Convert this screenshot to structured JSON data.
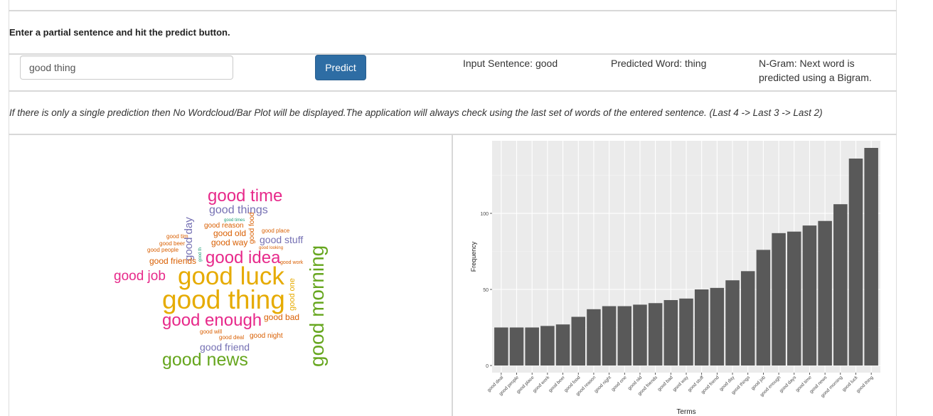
{
  "instructions": "Enter a partial sentence and hit the predict button.",
  "input": {
    "value": "good thing"
  },
  "predict_button_label": "Predict",
  "results": {
    "input_sentence": "Input Sentence: good",
    "predicted_word": "Predicted Word: thing",
    "ngram_line1": "N-Gram: Next word is",
    "ngram_line2": "predicted using a Bigram."
  },
  "note": "If there is only a single prediction then No Wordcloud/Bar Plot will be displayed.The application will always check using the last set of words of the entered sentence. (Last 4 -> Last 3 -> Last 2)",
  "wordcloud": {
    "words": [
      {
        "text": "good time",
        "color": "#e7298a"
      },
      {
        "text": "good things",
        "color": "#7570b3"
      },
      {
        "text": "good times",
        "color": "#1b9e77"
      },
      {
        "text": "good reason",
        "color": "#d95f02"
      },
      {
        "text": "good old",
        "color": "#d95f02"
      },
      {
        "text": "good place",
        "color": "#d95f02"
      },
      {
        "text": "good tim",
        "color": "#d95f02"
      },
      {
        "text": "good beer",
        "color": "#d95f02"
      },
      {
        "text": "good people",
        "color": "#d95f02"
      },
      {
        "text": "good way",
        "color": "#d95f02"
      },
      {
        "text": "good stuff",
        "color": "#7570b3"
      },
      {
        "text": "good looking",
        "color": "#d95f02"
      },
      {
        "text": "good day",
        "color": "#7570b3"
      },
      {
        "text": "good food",
        "color": "#d95f02"
      },
      {
        "text": "good th",
        "color": "#1b9e77"
      },
      {
        "text": "good friends",
        "color": "#d95f02"
      },
      {
        "text": "good idea",
        "color": "#e7298a"
      },
      {
        "text": "good work",
        "color": "#d95f02"
      },
      {
        "text": "good job",
        "color": "#e7298a"
      },
      {
        "text": "good luck",
        "color": "#e6ab02"
      },
      {
        "text": "good morning",
        "color": "#66a61e"
      },
      {
        "text": "good one",
        "color": "#e6ab02"
      },
      {
        "text": "good thing",
        "color": "#e6ab02"
      },
      {
        "text": "good enough",
        "color": "#e7298a"
      },
      {
        "text": "good bad",
        "color": "#d95f02"
      },
      {
        "text": "good will",
        "color": "#d95f02"
      },
      {
        "text": "good deal",
        "color": "#d95f02"
      },
      {
        "text": "good night",
        "color": "#d95f02"
      },
      {
        "text": "good friend",
        "color": "#7570b3"
      },
      {
        "text": "good news",
        "color": "#66a61e"
      }
    ]
  },
  "chart_data": {
    "type": "bar",
    "xlabel": "Terms",
    "ylabel": "Frequency",
    "ylim": [
      0,
      143
    ],
    "yticks": [
      0,
      50,
      100
    ],
    "categories": [
      "good deal",
      "good people",
      "good place",
      "good work",
      "good beer",
      "good food",
      "good reason",
      "good night",
      "good one",
      "good old",
      "good friends",
      "good bad",
      "good way",
      "good stuff",
      "good friend",
      "good day",
      "good things",
      "good job",
      "good enough",
      "good days",
      "good time",
      "good news",
      "good morning",
      "good luck",
      "good thing"
    ],
    "values": [
      25,
      25,
      25,
      26,
      27,
      32,
      37,
      39,
      39,
      40,
      41,
      43,
      44,
      50,
      51,
      56,
      62,
      76,
      87,
      88,
      92,
      95,
      106,
      136,
      143
    ],
    "bar_color": "#595959",
    "panel_color": "#ebebeb",
    "grid": true
  }
}
